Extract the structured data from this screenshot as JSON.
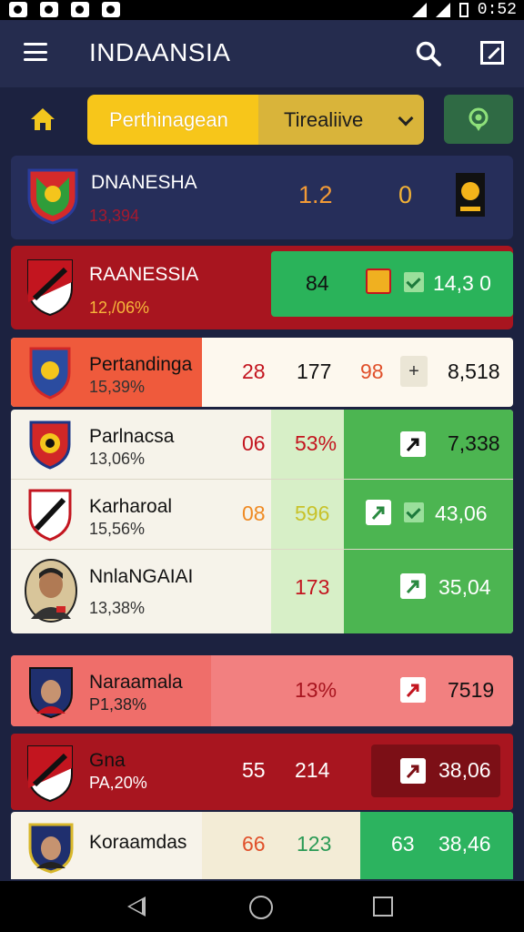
{
  "status_bar": {
    "time": "0:52"
  },
  "header": {
    "title": "INDAANSIA"
  },
  "filter": {
    "left_tab": "Perthinagean",
    "right_tab": "Tirealiive"
  },
  "rows": [
    {
      "name": "DNANESHA",
      "sub": "13,394",
      "score1": "1.2",
      "score2": "0"
    },
    {
      "name": "RAANESSIA",
      "sub": "12,/06%",
      "v1": "84",
      "v2": "14,3 0"
    },
    {
      "name": "Pertandinga",
      "sub": "15,39%",
      "v1": "28",
      "v2": "177",
      "v3": "98",
      "plus": "+",
      "v4": "8,518"
    },
    {
      "name": "Parlnacsa",
      "sub": "13,06%",
      "v1": "06",
      "v2": "53%",
      "v3": "7,338"
    },
    {
      "name": "Karharoal",
      "sub": "15,56%",
      "v1": "08",
      "v2": "596",
      "v3": "43,06"
    },
    {
      "name": "NnlaNGAIAI",
      "sub": "13,38%",
      "v1": "173",
      "v2": "35,04"
    },
    {
      "name": "Naraamala",
      "sub": "P1,38%",
      "v1": "13%",
      "v2": "7519"
    },
    {
      "name": "Gna",
      "sub": "PA,20%",
      "v1": "55",
      "v2": "214",
      "v3": "38,06"
    },
    {
      "name": "Koraamdas",
      "v1": "66",
      "v2": "123",
      "v3": "63",
      "v4": "38,46"
    }
  ],
  "icons": [
    "menu-icon",
    "search-icon",
    "edit-icon",
    "home-icon",
    "location-icon",
    "back-icon",
    "home-circle-icon",
    "recent-apps-icon"
  ],
  "colors": {
    "bg": "#1c2240",
    "appbar": "#252c4e",
    "accent_yellow": "#f7c61a",
    "green": "#30b060",
    "red": "#a8151f"
  }
}
